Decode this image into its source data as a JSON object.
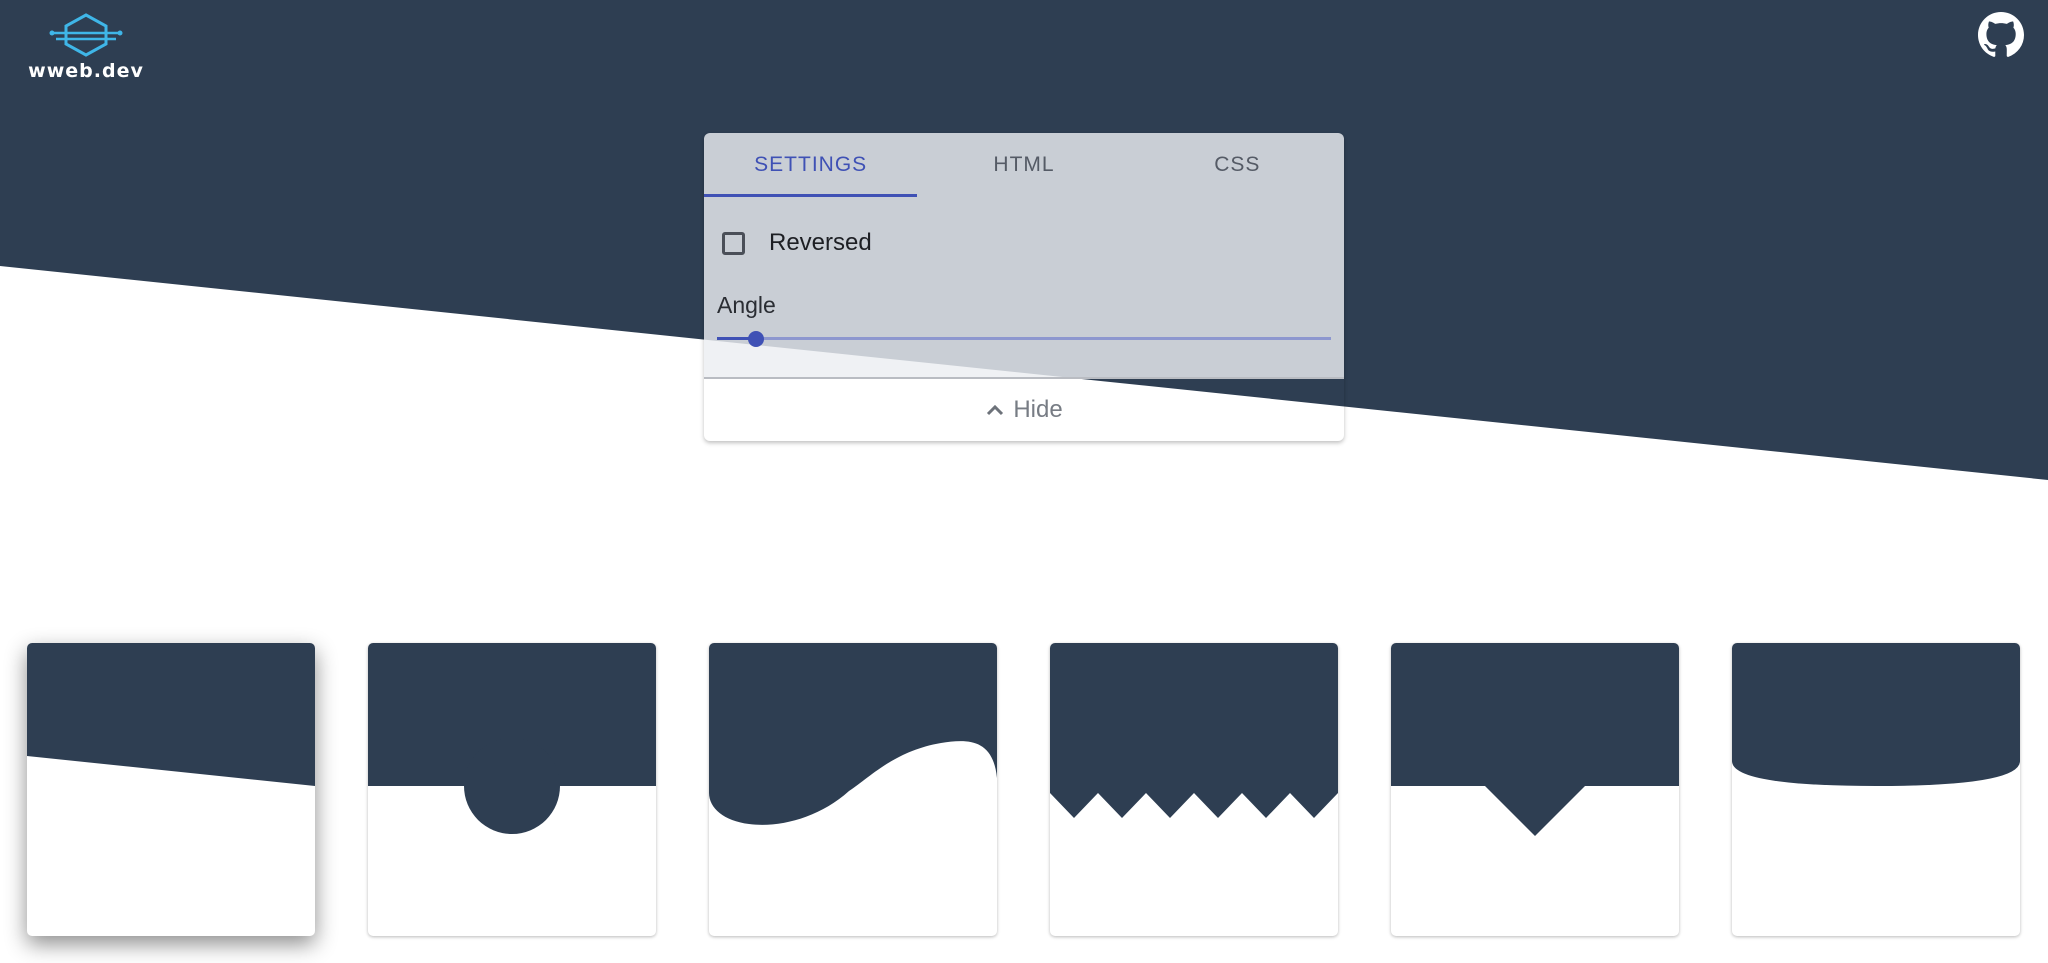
{
  "header": {
    "logo_text": "wweb.dev",
    "logo_icon": "hexagon-circuit-logo",
    "github_icon": "github-icon"
  },
  "colors": {
    "navy": "#2e3e52",
    "accent": "#3f51b5",
    "logo_cyan": "#3fb6e8"
  },
  "panel": {
    "tabs": [
      {
        "label": "SETTINGS",
        "active": true
      },
      {
        "label": "HTML",
        "active": false
      },
      {
        "label": "CSS",
        "active": false
      }
    ],
    "reversed_label": "Reversed",
    "reversed_checked": false,
    "angle_label": "Angle",
    "angle_value_fraction": 0.05,
    "hide_label": "Hide",
    "hide_icon": "chevron-up-icon"
  },
  "cards": [
    {
      "name": "slant-divider-card",
      "selected": true
    },
    {
      "name": "circle-divider-card",
      "selected": false
    },
    {
      "name": "wave-divider-card",
      "selected": false
    },
    {
      "name": "zigzag-divider-card",
      "selected": false
    },
    {
      "name": "triangle-divider-card",
      "selected": false
    },
    {
      "name": "curve-divider-card",
      "selected": false
    }
  ]
}
